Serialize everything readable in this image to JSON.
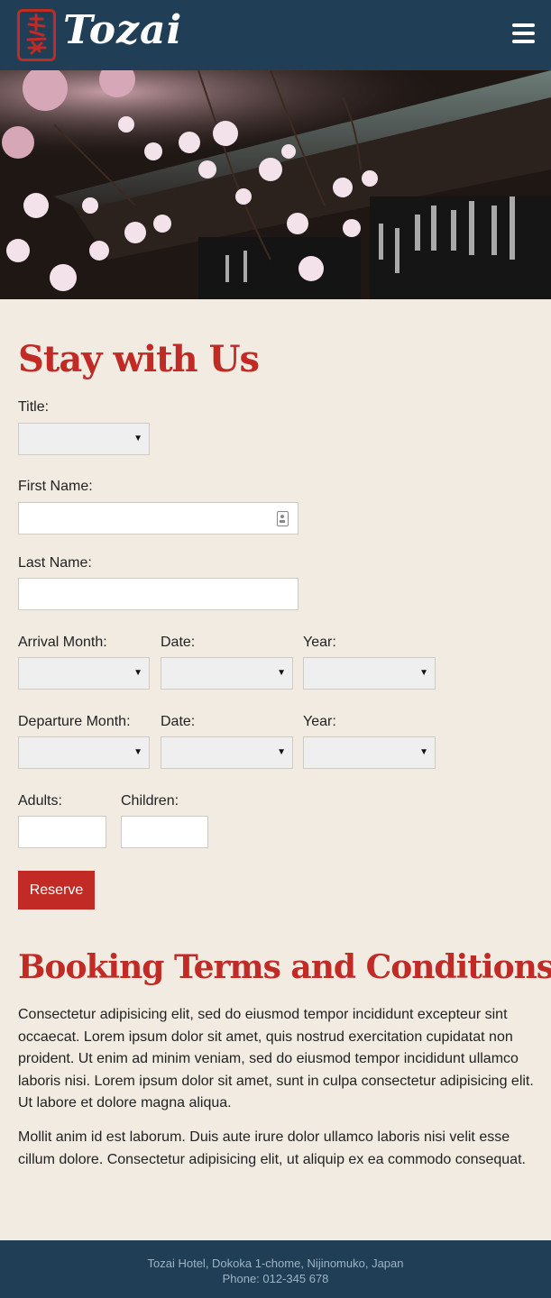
{
  "header": {
    "brand": "Tozai",
    "menu_icon": "hamburger-menu-icon",
    "logo_icon": "tozai-kanji-logo-icon"
  },
  "form": {
    "heading": "Stay with Us",
    "title_label": "Title:",
    "first_name_label": "First Name:",
    "last_name_label": "Last Name:",
    "arrival_month_label": "Arrival Month:",
    "arrival_date_label": "Date:",
    "arrival_year_label": "Year:",
    "departure_month_label": "Departure Month:",
    "departure_date_label": "Date:",
    "departure_year_label": "Year:",
    "adults_label": "Adults:",
    "children_label": "Children:",
    "reserve_label": "Reserve"
  },
  "terms": {
    "heading": "Booking Terms and Conditions",
    "para1": "Consectetur adipisicing elit, sed do eiusmod tempor incididunt excepteur sint occaecat. Lorem ipsum dolor sit amet, quis nostrud exercitation cupidatat non proident. Ut enim ad minim veniam, sed do eiusmod tempor incididunt ullamco laboris nisi. Lorem ipsum dolor sit amet, sunt in culpa consectetur adipisicing elit. Ut labore et dolore magna aliqua.",
    "para2": "Mollit anim id est laborum. Duis aute irure dolor ullamco laboris nisi velit esse cillum dolore. Consectetur adipisicing elit, ut aliquip ex ea commodo consequat."
  },
  "footer": {
    "address": "Tozai Hotel, Dokoka 1-chome, Nijinomuko, Japan",
    "phone": "Phone: 012-345 678"
  },
  "colors": {
    "header_bg": "#203f56",
    "accent_red": "#c12a25",
    "page_bg": "#f1ebe2"
  }
}
